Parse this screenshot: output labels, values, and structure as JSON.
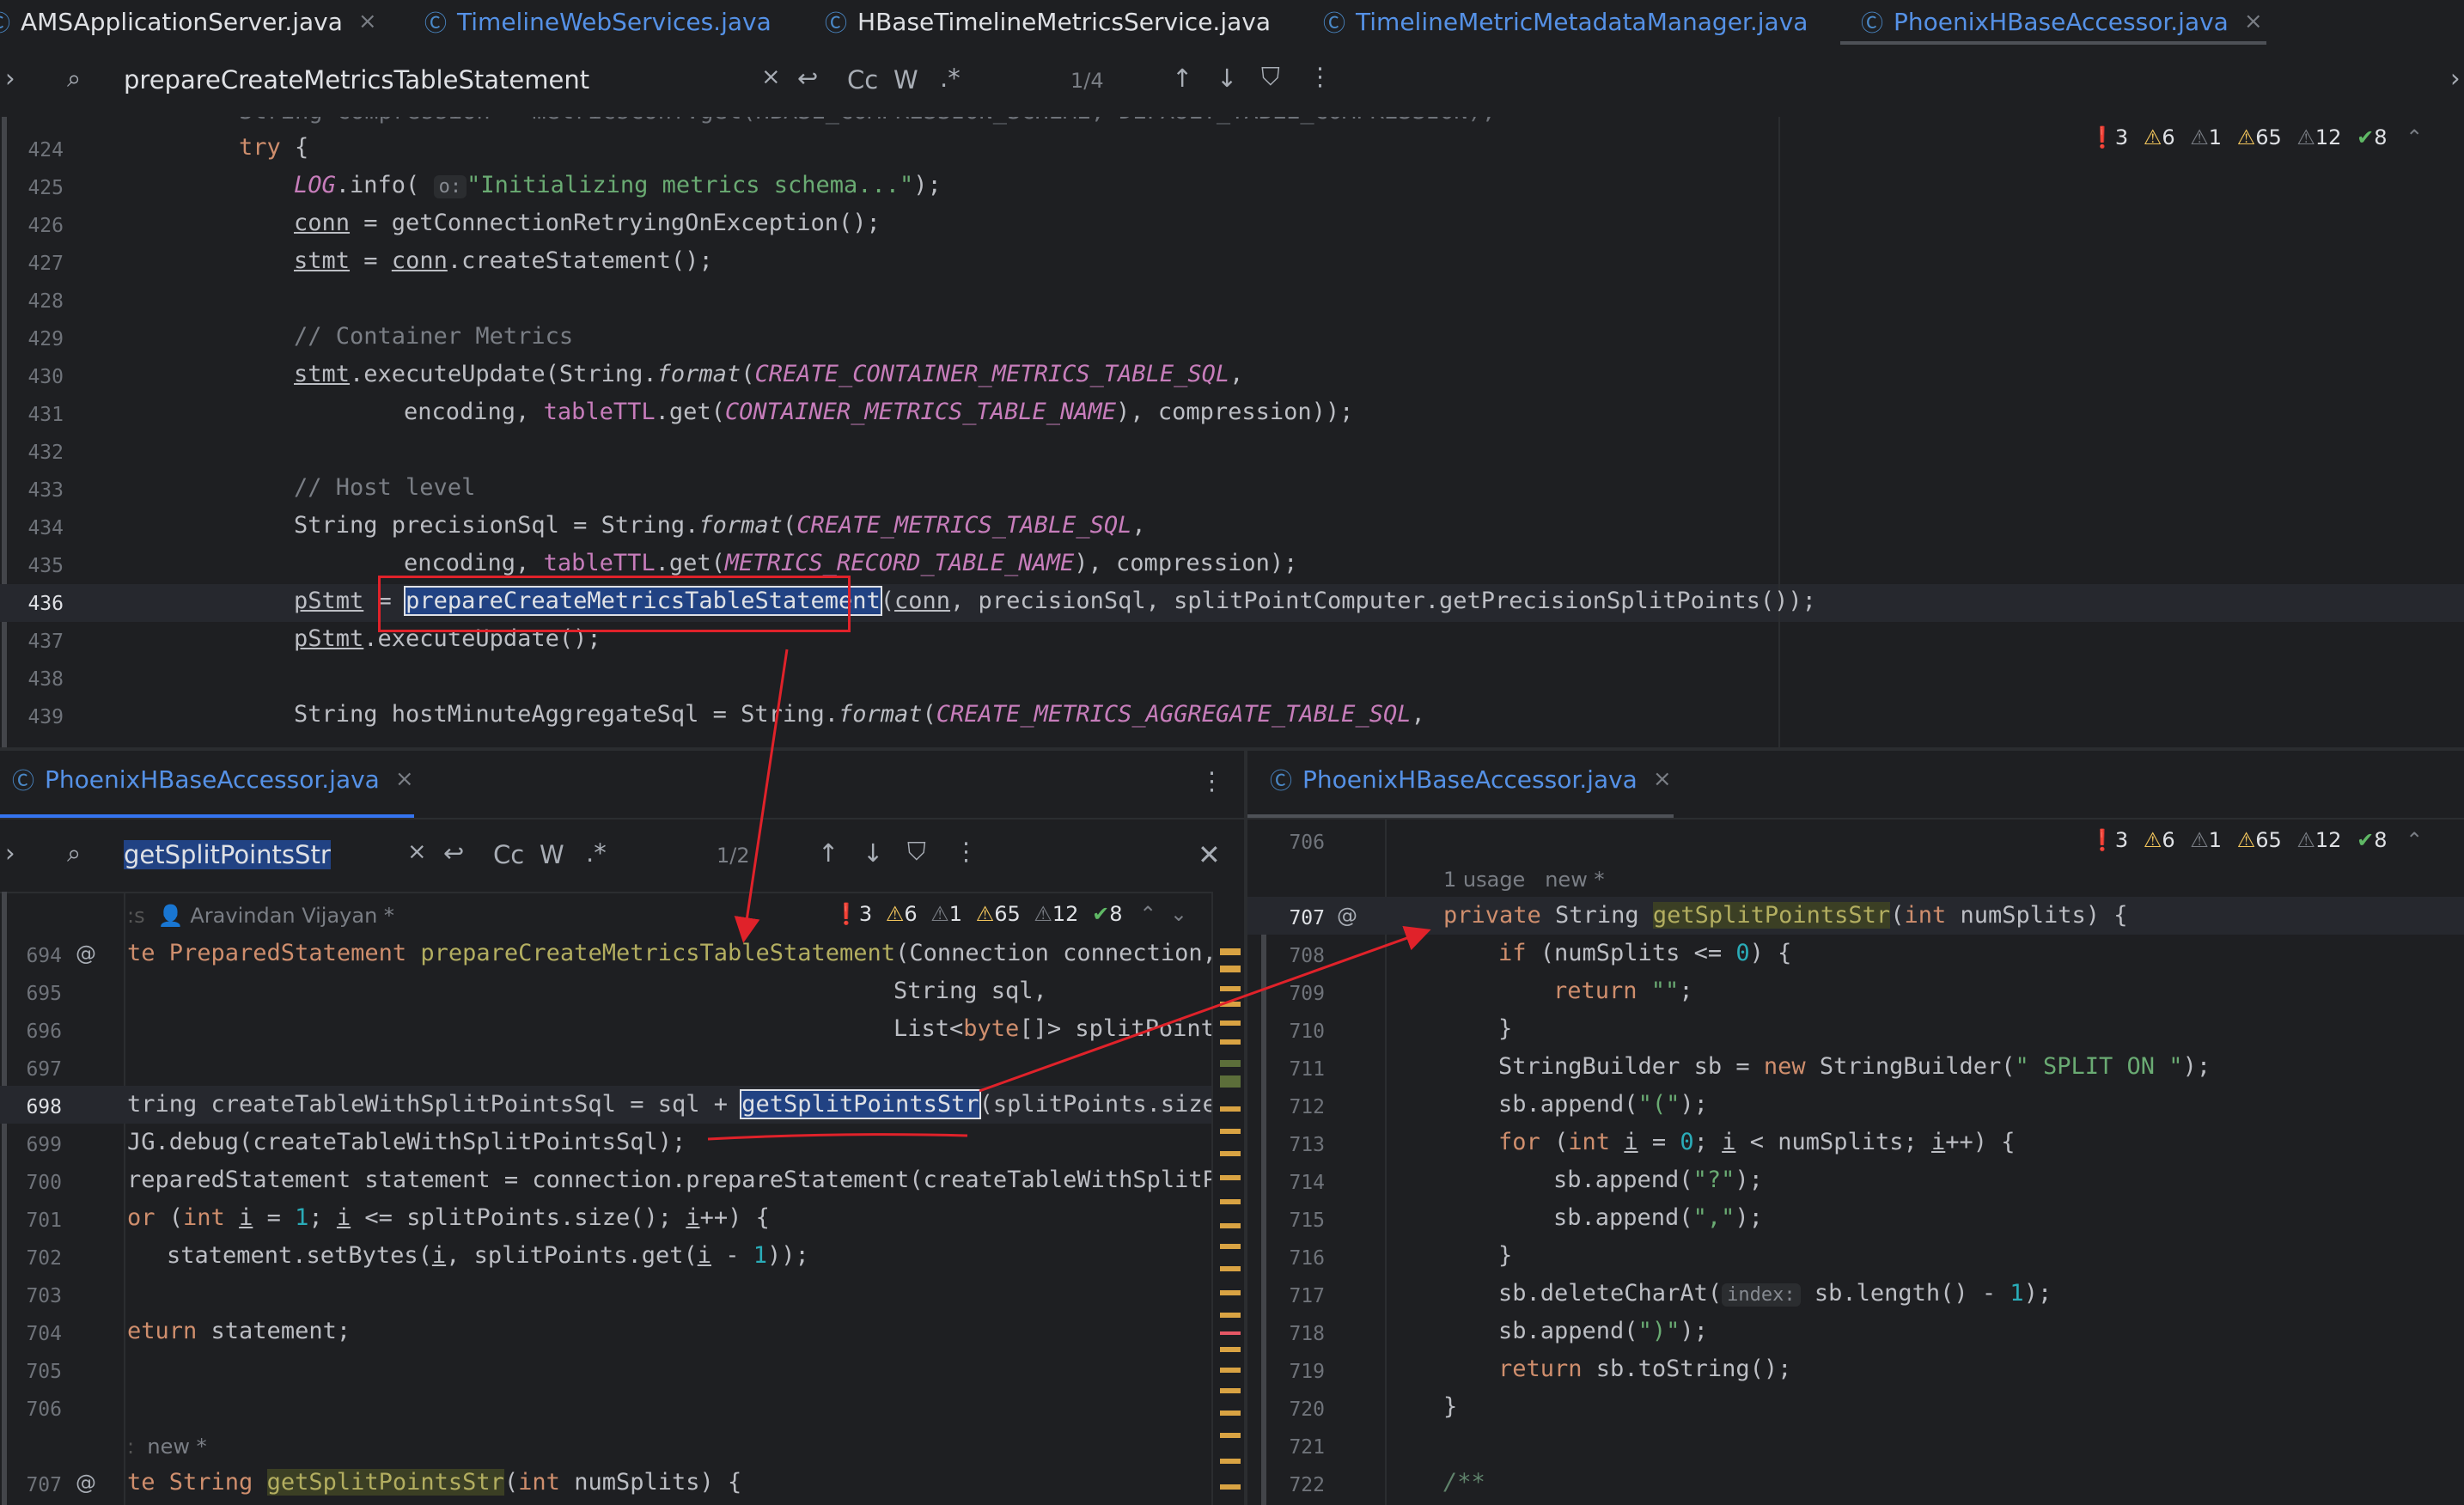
{
  "tabs": [
    {
      "label": "AMSApplicationServer.java",
      "close": "×"
    },
    {
      "label": "TimelineWebServices.java"
    },
    {
      "label": "HBaseTimelineMetricsService.java"
    },
    {
      "label": "TimelineMetricMetadataManager.java"
    },
    {
      "label": "PhoenixHBaseAccessor.java",
      "close": "×"
    }
  ],
  "top_find": {
    "query": "prepareCreateMetricsTableStatement",
    "count": "1/4",
    "clear": "×",
    "cc": "Cc",
    "w": "W",
    "regex": ".*"
  },
  "inspection": {
    "errors": "3",
    "warnings": "6",
    "weak": "1",
    "typos": "65",
    "other": "12",
    "ok": "8"
  },
  "top_lines": [
    "424",
    "425",
    "426",
    "427",
    "428",
    "429",
    "430",
    "431",
    "432",
    "433",
    "434",
    "435",
    "436",
    "437",
    "438",
    "439"
  ],
  "top_code": {
    "l424": "try",
    "l425_a": "LOG",
    "l425_b": ".info(",
    "l425_hint": "o:",
    "l425_str": "\"Initializing metrics schema...\"",
    "l425_c": ");",
    "l426_a": "conn",
    "l426_b": " = getConnectionRetryingOnException();",
    "l427_a": "stmt",
    "l427_b": " = ",
    "l427_c": "conn",
    "l427_d": ".createStatement();",
    "l429": "// Container Metrics",
    "l430_a": "stmt",
    "l430_b": ".executeUpdate(String.",
    "l430_c": "format",
    "l430_d": "(",
    "l430_e": "CREATE_CONTAINER_METRICS_TABLE_SQL",
    "l430_f": ",",
    "l431_a": "encoding, ",
    "l431_b": "tableTTL",
    "l431_c": ".get(",
    "l431_d": "CONTAINER_METRICS_TABLE_NAME",
    "l431_e": "), compression));",
    "l433": "// Host level",
    "l434_a": "String precisionSql = String.",
    "l434_b": "format",
    "l434_c": "(",
    "l434_d": "CREATE_METRICS_TABLE_SQL",
    "l434_e": ",",
    "l435_a": "encoding, ",
    "l435_b": "tableTTL",
    "l435_c": ".get(",
    "l435_d": "METRICS_RECORD_TABLE_NAME",
    "l435_e": "), compression);",
    "l436_a": "pStmt",
    "l436_b": " = ",
    "l436_c": "prepareCreateMetricsTableStatement",
    "l436_d": "(",
    "l436_e": "conn",
    "l436_f": ", precisionSql, splitPointComputer.getPrecisionSplitPoints());",
    "l437_a": "pStmt",
    "l437_b": ".executeUpdate();",
    "l439_a": "String hostMinuteAggregateSql = String.",
    "l439_b": "format",
    "l439_c": "(",
    "l439_d": "CREATE_METRICS_AGGREGATE_TABLE_SQL",
    "l439_e": ","
  },
  "left_tab": {
    "label": "PhoenixHBaseAccessor.java",
    "close": "×"
  },
  "left_find": {
    "query": "getSplitPointsStr",
    "count": "1/2",
    "clear": "×",
    "cc": "Cc",
    "w": "W",
    "regex": ".*"
  },
  "left_author": "Aravindan Vijayan *",
  "left_lines": [
    "694",
    "695",
    "696",
    "697",
    "698",
    "699",
    "700",
    "701",
    "702",
    "703",
    "704",
    "705",
    "706",
    "707"
  ],
  "left_code": {
    "l694_a": "te PreparedStatement ",
    "l694_b": "prepareCreateMetricsTableStatement",
    "l694_c": "(Connection connection,",
    "l695": "String sql,",
    "l696_a": "List<",
    "l696_b": "byte",
    "l696_c": "[]> splitPoints)",
    "l698_a": "tring createTableWithSplitPointsSql = sql + ",
    "l698_b": "getSplitPointsStr",
    "l698_c": "(splitPoints.size());",
    "l699": "JG.debug(createTableWithSplitPointsSql);",
    "l700": "reparedStatement statement = connection.prepareStatement(createTableWithSplitPoints",
    "l701_a": "or",
    "l701_b": " (",
    "l701_c": "int",
    "l701_d": "i",
    "l701_e": " = ",
    "l701_f": "1",
    "l701_g": "; ",
    "l701_h": "i",
    "l701_i": " <= splitPoints.size(); ",
    "l701_j": "i",
    "l701_k": "++) {",
    "l702_a": "statement.setBytes(",
    "l702_b": "i",
    "l702_c": ", splitPoints.get(",
    "l702_d": "i",
    "l702_e": " - ",
    "l702_f": "1",
    "l702_g": "));",
    "l704_a": "eturn",
    "l704_b": " statement;",
    "l706_usage": "new *",
    "l707_a": "te String ",
    "l707_b": "getSplitPointsStr",
    "l707_c": "(",
    "l707_d": "int",
    "l707_e": " numSplits) {"
  },
  "right_tab": {
    "label": "PhoenixHBaseAccessor.java",
    "close": "×"
  },
  "right_usage": "1 usage",
  "right_new": "new *",
  "right_lines": [
    "706",
    "707",
    "708",
    "709",
    "710",
    "711",
    "712",
    "713",
    "714",
    "715",
    "716",
    "717",
    "718",
    "719",
    "720",
    "721",
    "722"
  ],
  "right_code": {
    "l707_a": "private",
    "l707_b": " String ",
    "l707_c": "getSplitPointsStr",
    "l707_d": "(",
    "l707_e": "int",
    "l707_f": " numSplits) {",
    "l708_a": "if",
    "l708_b": " (numSplits <= ",
    "l708_c": "0",
    "l708_d": ") {",
    "l709_a": "return",
    "l709_b": " \"\"",
    "l709_c": ";",
    "l710": "}",
    "l711_a": "StringBuilder sb = ",
    "l711_b": "new",
    "l711_c": " StringBuilder(",
    "l711_d": "\" SPLIT ON \"",
    "l711_e": ");",
    "l712_a": "sb.append(",
    "l712_b": "\"(\"",
    "l712_c": ");",
    "l713_a": "for",
    "l713_b": " (",
    "l713_c": "int",
    "l713_d": "i",
    "l713_e": " = ",
    "l713_f": "0",
    "l713_g": "; ",
    "l713_h": "i",
    "l713_i": " < numSplits; ",
    "l713_j": "i",
    "l713_k": "++) {",
    "l714_a": "sb.append(",
    "l714_b": "\"?\"",
    "l714_c": ");",
    "l715_a": "sb.append(",
    "l715_b": "\",\"",
    "l715_c": ");",
    "l716": "}",
    "l717_a": "sb.deleteCharAt(",
    "l717_hint": "index:",
    "l717_b": " sb.length() - ",
    "l717_c": "1",
    "l717_d": ");",
    "l718_a": "sb.append(",
    "l718_b": "\")\"",
    "l718_c": ");",
    "l719_a": "return",
    "l719_b": " sb.toString();",
    "l720": "}",
    "l722": "/**"
  },
  "colors": {
    "annotation": "#e0222a",
    "accent": "#3574f0",
    "background": "#1e1f22"
  },
  "icons": [
    "class-icon",
    "search-icon",
    "wrap-icon",
    "arrow-up-icon",
    "arrow-down-icon",
    "filter-icon",
    "more-icon",
    "close-icon",
    "error-icon",
    "warning-icon",
    "check-icon",
    "at-icon",
    "expand-icon",
    "user-icon"
  ]
}
